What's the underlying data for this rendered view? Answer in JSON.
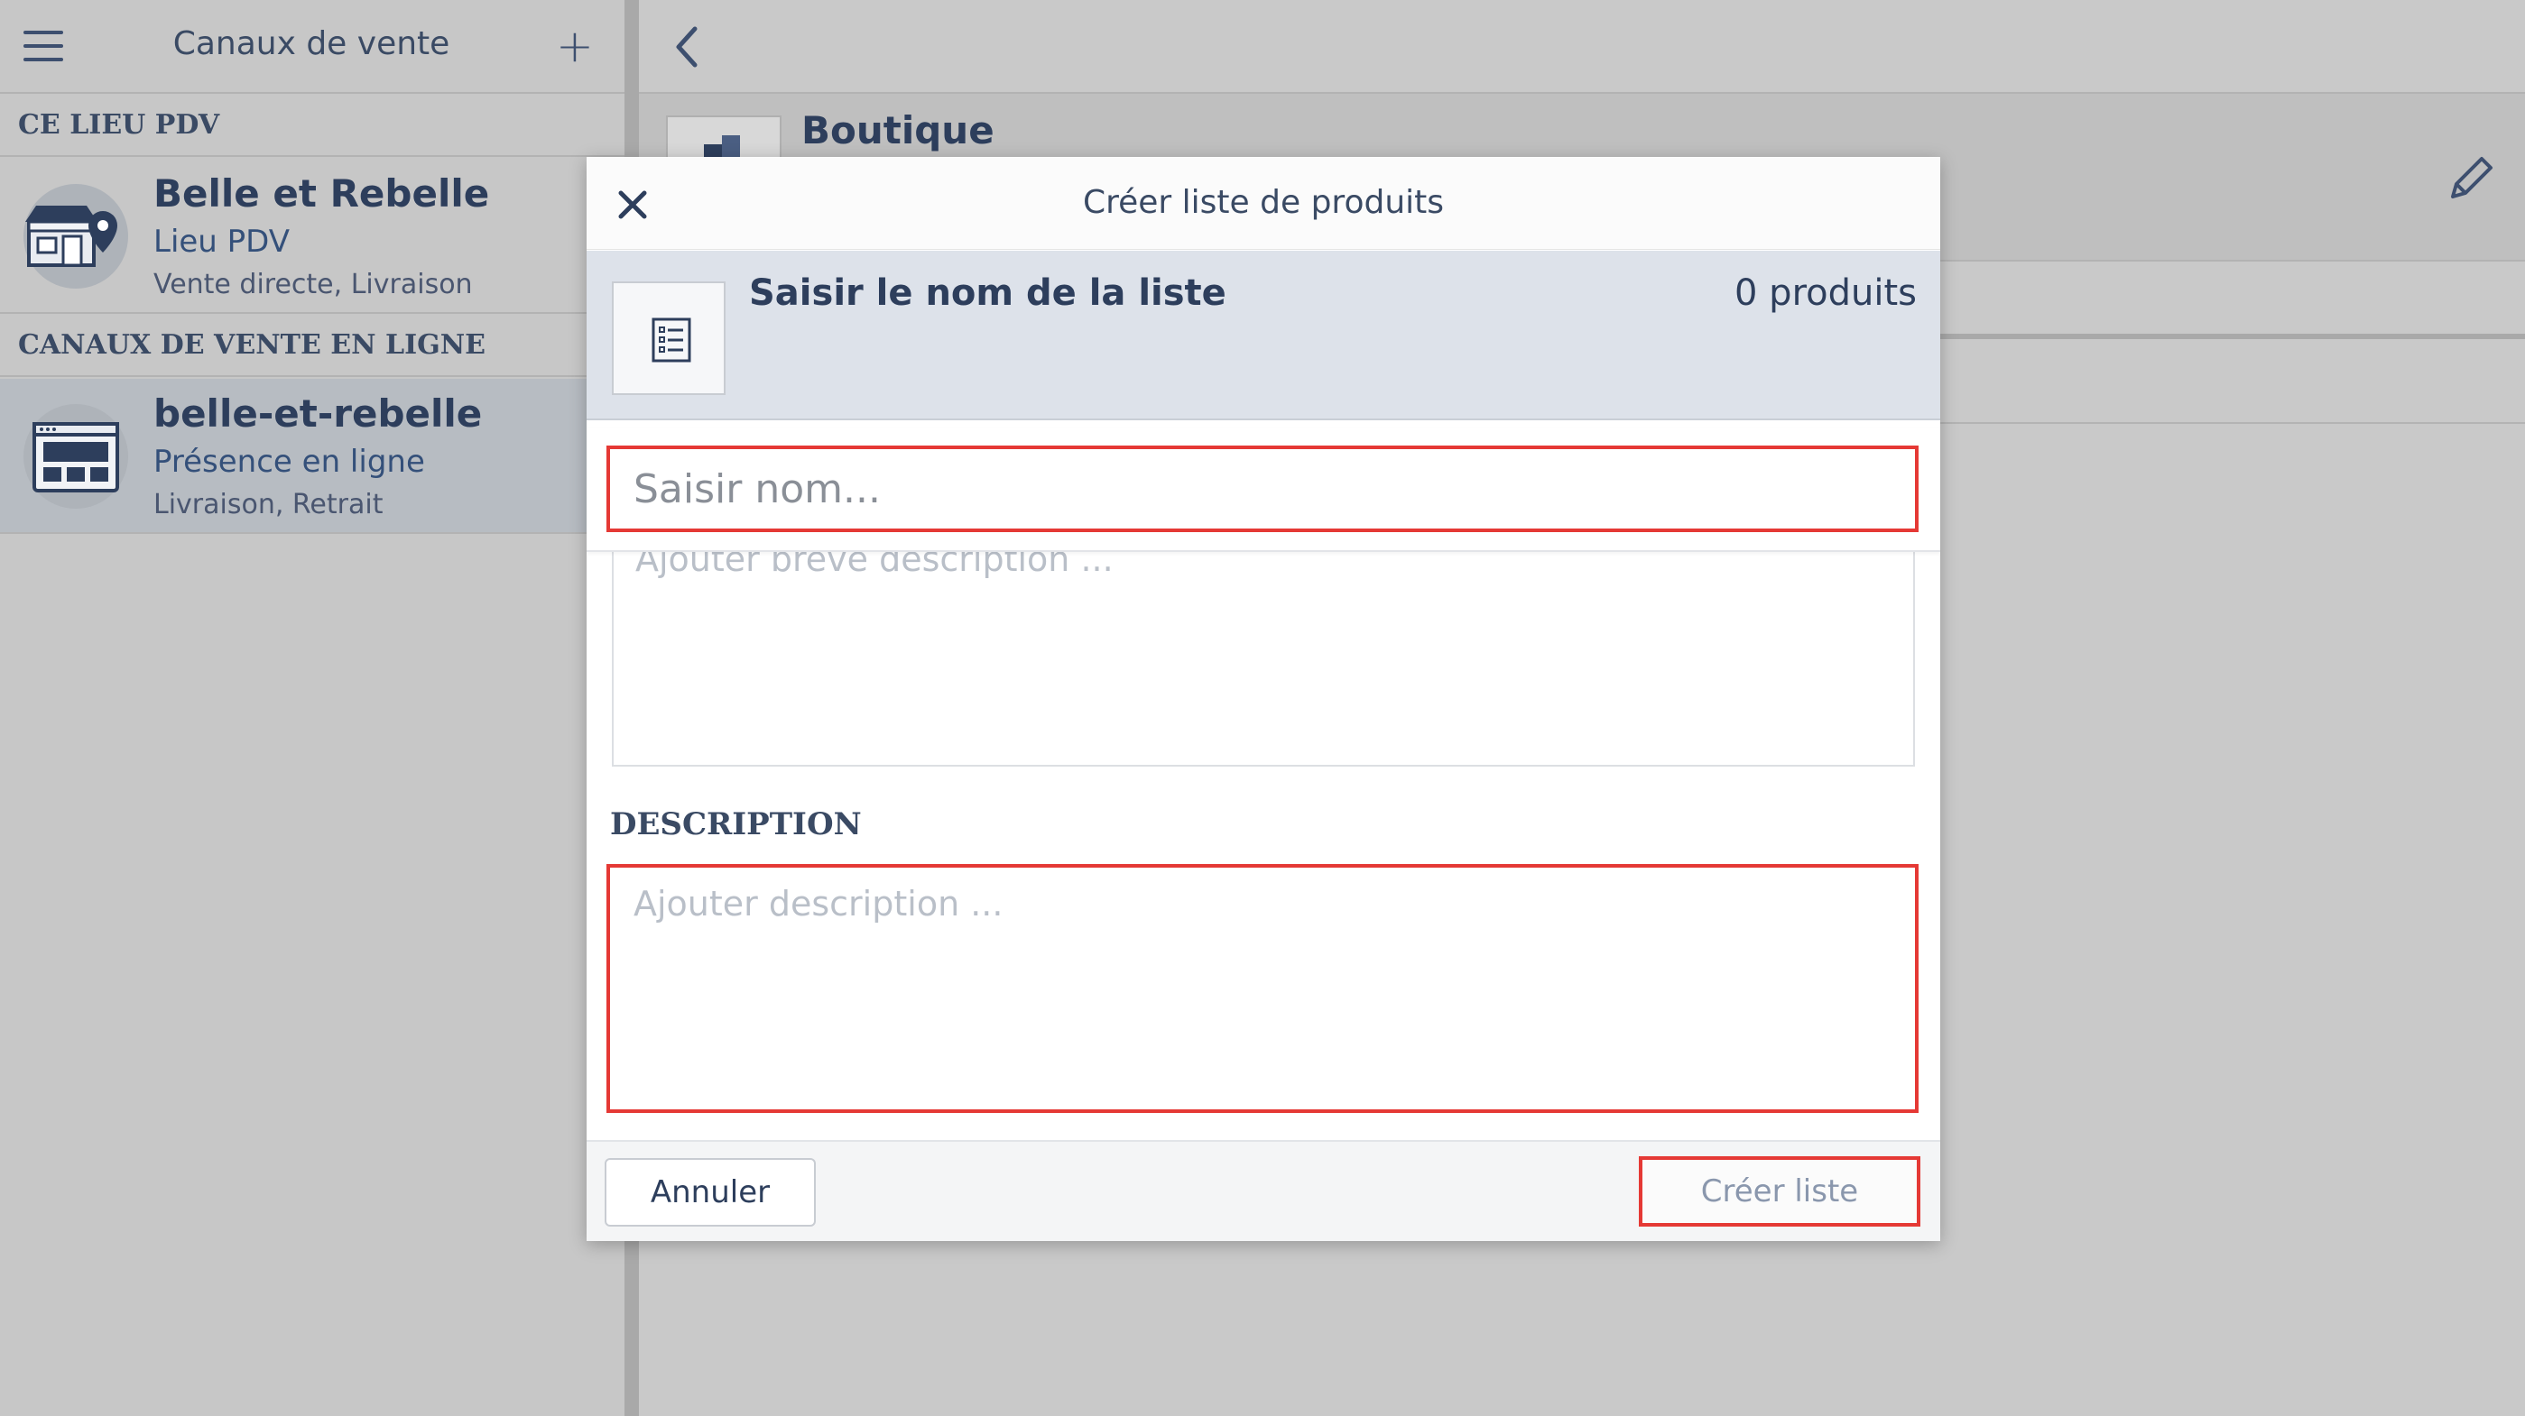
{
  "sidebar": {
    "title": "Canaux de vente",
    "sections": [
      {
        "heading": "CE LIEU PDV",
        "items": [
          {
            "name": "Belle et Rebelle",
            "type": "Lieu PDV",
            "modes": "Vente directe, Livraison",
            "icon": "store-location-icon"
          }
        ]
      },
      {
        "heading": "CANAUX DE VENTE EN LIGNE",
        "items": [
          {
            "name": "belle-et-rebelle",
            "type": "Présence en ligne",
            "modes": "Livraison, Retrait",
            "icon": "website-icon"
          }
        ]
      }
    ]
  },
  "main": {
    "shop_title": "Boutique"
  },
  "modal": {
    "title": "Créer liste de produits",
    "summary": {
      "name": "Saisir le nom de la liste",
      "count": "0 produits"
    },
    "name_input": {
      "placeholder": "Saisir nom...",
      "value": ""
    },
    "short_description": {
      "placeholder": "Ajouter brève description ..."
    },
    "description": {
      "label": "DESCRIPTION",
      "placeholder": "Ajouter description ..."
    },
    "cancel_label": "Annuler",
    "create_label": "Créer liste"
  },
  "colors": {
    "accent": "#2d3e5c",
    "highlight": "#e53935",
    "overlay": "#c5c5c5"
  }
}
